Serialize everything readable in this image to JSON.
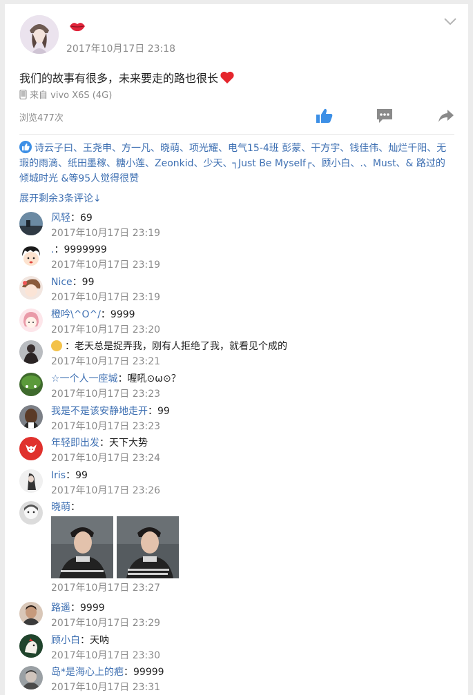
{
  "post": {
    "time": "2017年10月17日 23:18",
    "text": "我们的故事有很多，未来要走的路也很长",
    "device": "来自 vivo X6S (4G)",
    "views": "浏览477次"
  },
  "likes": {
    "text": "诗云子曰、王尧申、方一凡、晓萌、项光耀、电气15-4班 彭蒙、干方宇、钱佳伟、灿烂千阳、无瑕的雨滴、纸田墨稼、糖小莲、Zeonkid、少天、┐Just Be Myself┌、顾小白、.、Must、& 路过的倾城时光 &等95人觉得很赞"
  },
  "expand_label": "展开剩余3条评论↓",
  "comments": [
    {
      "user": "风轻",
      "text": "：69",
      "time": "2017年10月17日 23:19"
    },
    {
      "user": ".",
      "text": "：9999999",
      "time": "2017年10月17日 23:19"
    },
    {
      "user": "Nice",
      "text": "：99",
      "time": "2017年10月17日 23:19"
    },
    {
      "user": "橙吟\\^O^/",
      "text": "：9999",
      "time": "2017年10月17日 23:20"
    },
    {
      "user": "",
      "text": "：老天总是捉弄我，刚有人拒绝了我，就看见个成的",
      "time": "2017年10月17日 23:21"
    },
    {
      "user": "☆一个人一座城",
      "text": "：喔吼⊙ω⊙？",
      "time": "2017年10月17日 23:23"
    },
    {
      "user": "我是不是该安静地走开",
      "text": "：99",
      "time": "2017年10月17日 23:23"
    },
    {
      "user": "年轻即出发",
      "text": "：天下大势",
      "time": "2017年10月17日 23:24"
    },
    {
      "user": "Iris",
      "text": "：99",
      "time": "2017年10月17日 23:26"
    },
    {
      "user": "晓萌",
      "text": "：",
      "time": "2017年10月17日 23:27"
    },
    {
      "user": "路遥",
      "text": "：9999",
      "time": "2017年10月17日 23:29"
    },
    {
      "user": "顾小白",
      "text": "：天呐",
      "time": "2017年10月17日 23:30"
    },
    {
      "user": "岛*是海心上的疤",
      "text": "：99999",
      "time": "2017年10月17日 23:31"
    }
  ],
  "colors": {
    "link": "#3d6fb2",
    "accent": "#3c8fe6",
    "muted": "#8a8a8a"
  }
}
